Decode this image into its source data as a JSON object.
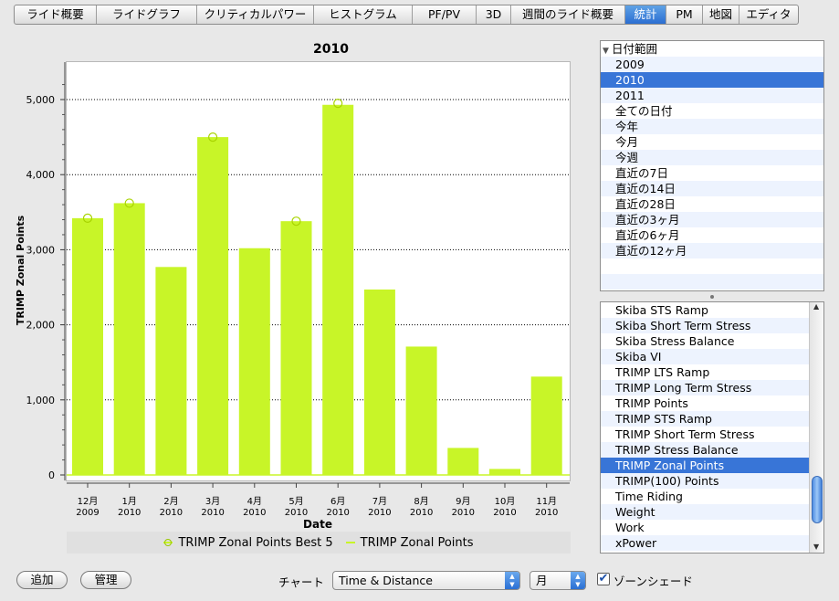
{
  "tabs": [
    {
      "label": "ライド概要",
      "active": false
    },
    {
      "label": "ライドグラフ",
      "active": false
    },
    {
      "label": "クリティカルパワー",
      "active": false
    },
    {
      "label": "ヒストグラム",
      "active": false
    },
    {
      "label": "PF/PV",
      "active": false
    },
    {
      "label": "3D",
      "active": false
    },
    {
      "label": "週間のライド概要",
      "active": false
    },
    {
      "label": "統計",
      "active": true
    },
    {
      "label": "PM",
      "active": false
    },
    {
      "label": "地図",
      "active": false
    },
    {
      "label": "エディタ",
      "active": false
    }
  ],
  "chart_data": {
    "type": "bar",
    "title": "2010",
    "xlabel": "Date",
    "ylabel": "TRIMP Zonal Points",
    "ylim": [
      0,
      5400
    ],
    "yticks": [
      0,
      1000,
      2000,
      3000,
      4000,
      5000
    ],
    "ytick_labels": [
      "0",
      "1,000",
      "2,000",
      "3,000",
      "4,000",
      "5,000"
    ],
    "grid": "horizontal-dotted",
    "legend_position": "bottom",
    "categories": [
      {
        "month": "12月",
        "year": "2009"
      },
      {
        "month": "1月",
        "year": "2010"
      },
      {
        "month": "2月",
        "year": "2010"
      },
      {
        "month": "3月",
        "year": "2010"
      },
      {
        "month": "4月",
        "year": "2010"
      },
      {
        "month": "5月",
        "year": "2010"
      },
      {
        "month": "6月",
        "year": "2010"
      },
      {
        "month": "7月",
        "year": "2010"
      },
      {
        "month": "8月",
        "year": "2010"
      },
      {
        "month": "9月",
        "year": "2010"
      },
      {
        "month": "10月",
        "year": "2010"
      },
      {
        "month": "11月",
        "year": "2010"
      }
    ],
    "series": [
      {
        "name": "TRIMP Zonal Points Best 5",
        "marker": "circle",
        "color": "#c8f528",
        "values": [
          3420,
          3620,
          null,
          4500,
          null,
          3380,
          4950,
          null,
          null,
          null,
          null,
          null
        ]
      },
      {
        "name": "TRIMP Zonal Points",
        "marker": "bar",
        "color": "#c8f528",
        "values": [
          3420,
          3620,
          2770,
          4500,
          3020,
          3380,
          4930,
          2470,
          1710,
          360,
          80,
          1310
        ]
      }
    ]
  },
  "date_tree": {
    "root_label": "日付範囲",
    "items": [
      {
        "label": "2009",
        "selected": false
      },
      {
        "label": "2010",
        "selected": true
      },
      {
        "label": "2011",
        "selected": false
      },
      {
        "label": "全ての日付",
        "selected": false
      },
      {
        "label": "今年",
        "selected": false
      },
      {
        "label": "今月",
        "selected": false
      },
      {
        "label": "今週",
        "selected": false
      },
      {
        "label": "直近の7日",
        "selected": false
      },
      {
        "label": "直近の14日",
        "selected": false
      },
      {
        "label": "直近の28日",
        "selected": false
      },
      {
        "label": "直近の3ヶ月",
        "selected": false
      },
      {
        "label": "直近の6ヶ月",
        "selected": false
      },
      {
        "label": "直近の12ヶ月",
        "selected": false
      }
    ]
  },
  "metric_list": {
    "items": [
      {
        "label": "Skiba STS Ramp",
        "selected": false
      },
      {
        "label": "Skiba Short Term Stress",
        "selected": false
      },
      {
        "label": "Skiba Stress Balance",
        "selected": false
      },
      {
        "label": "Skiba VI",
        "selected": false
      },
      {
        "label": "TRIMP LTS Ramp",
        "selected": false
      },
      {
        "label": "TRIMP Long Term Stress",
        "selected": false
      },
      {
        "label": "TRIMP Points",
        "selected": false
      },
      {
        "label": "TRIMP STS Ramp",
        "selected": false
      },
      {
        "label": "TRIMP Short Term Stress",
        "selected": false
      },
      {
        "label": "TRIMP Stress Balance",
        "selected": false
      },
      {
        "label": "TRIMP Zonal Points",
        "selected": true
      },
      {
        "label": "TRIMP(100) Points",
        "selected": false
      },
      {
        "label": "Time Riding",
        "selected": false
      },
      {
        "label": "Weight",
        "selected": false
      },
      {
        "label": "Work",
        "selected": false
      },
      {
        "label": "xPower",
        "selected": false
      }
    ]
  },
  "bottom_bar": {
    "add_label": "追加",
    "manage_label": "管理",
    "chart_label": "チャート",
    "chart_select_value": "Time & Distance",
    "period_select_value": "月",
    "zone_shade_label": "ゾーンシェード",
    "zone_shade_checked": true
  },
  "colors": {
    "bar": "#c8f528",
    "selection": "#3875d7",
    "active_tab": "#2b6ed2"
  }
}
